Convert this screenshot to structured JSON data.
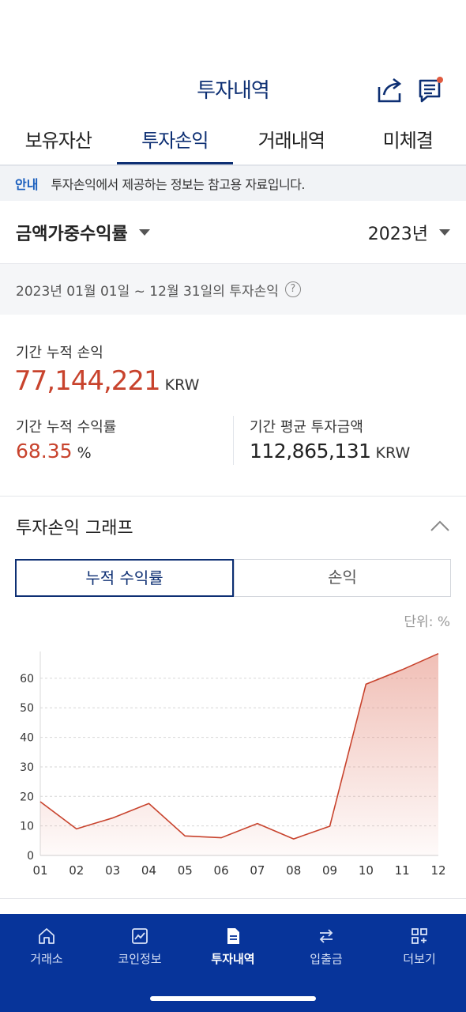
{
  "header": {
    "title": "투자내역"
  },
  "tabs": [
    "보유자산",
    "투자손익",
    "거래내역",
    "미체결"
  ],
  "info": {
    "tag": "안내",
    "text": "투자손익에서 제공하는 정보는 참고용 자료입니다."
  },
  "selectors": {
    "type": "금액가중수익률",
    "year": "2023년"
  },
  "period": {
    "text": "2023년 01월 01일 ~ 12월 31일의 투자손익"
  },
  "summary": {
    "cum_pl_label": "기간 누적 손익",
    "cum_pl_value": "77,144,221",
    "cum_pl_unit": "KRW",
    "cum_rate_label": "기간 누적 수익률",
    "cum_rate_value": "68.35",
    "cum_rate_unit": "%",
    "avg_invest_label": "기간 평균 투자금액",
    "avg_invest_value": "112,865,131",
    "avg_invest_unit": "KRW"
  },
  "graph": {
    "title": "투자손익 그래프",
    "toggle": [
      "누적 수익률",
      "손익"
    ],
    "unit_label": "단위: %"
  },
  "chart_data": {
    "type": "area",
    "x": [
      "01",
      "02",
      "03",
      "04",
      "05",
      "06",
      "07",
      "08",
      "09",
      "10",
      "11",
      "12"
    ],
    "values": [
      18.2,
      9.0,
      12.7,
      17.6,
      6.6,
      6.0,
      10.8,
      5.6,
      9.9,
      58.0,
      62.9,
      68.35
    ],
    "ylim": [
      0,
      68
    ],
    "yticks": [
      0,
      10,
      20,
      30,
      40,
      50,
      60
    ],
    "grid": true,
    "color": "#c8432d"
  },
  "nav": [
    {
      "label": "거래소",
      "icon": "home-icon"
    },
    {
      "label": "코인정보",
      "icon": "chart-icon"
    },
    {
      "label": "투자내역",
      "icon": "document-icon"
    },
    {
      "label": "입출금",
      "icon": "transfer-icon"
    },
    {
      "label": "더보기",
      "icon": "more-grid-icon"
    }
  ],
  "colors": {
    "brand": "#0d2f73",
    "nav_bg": "#07349a",
    "profit": "#c8432d",
    "info_tag": "#1b5fbe"
  }
}
